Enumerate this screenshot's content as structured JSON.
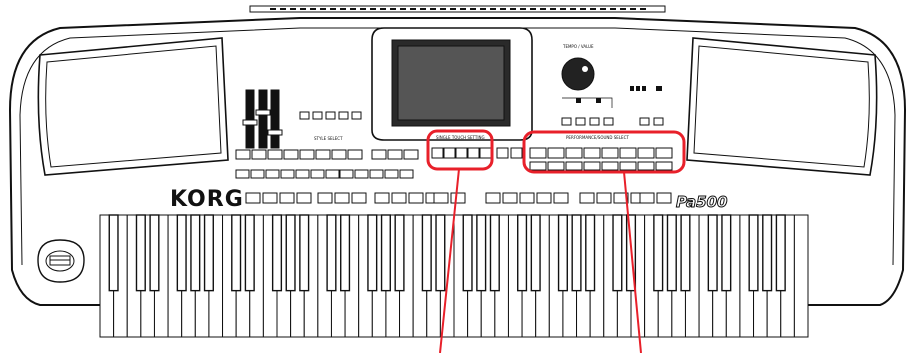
{
  "brand": {
    "logo": "KORG",
    "model": "Pa500"
  },
  "sections": {
    "style_select": "STYLE SELECT",
    "single_touch_setting": "SINGLE TOUCH SETTING",
    "performance_sound_select": "PERFORMANCE/SOUND SELECT",
    "tempo_value": "TEMPO / VALUE"
  },
  "callouts": [
    {
      "label": "SINGLE TOUCH SETTING buttons",
      "color": "#e8202a"
    },
    {
      "label": "PERFORMANCE/SOUND SELECT buttons",
      "color": "#e8202a"
    }
  ],
  "colors": {
    "line": "#111111",
    "highlight": "#e8202a",
    "body": "#ffffff"
  },
  "keyboard": {
    "white_keys": 52
  }
}
